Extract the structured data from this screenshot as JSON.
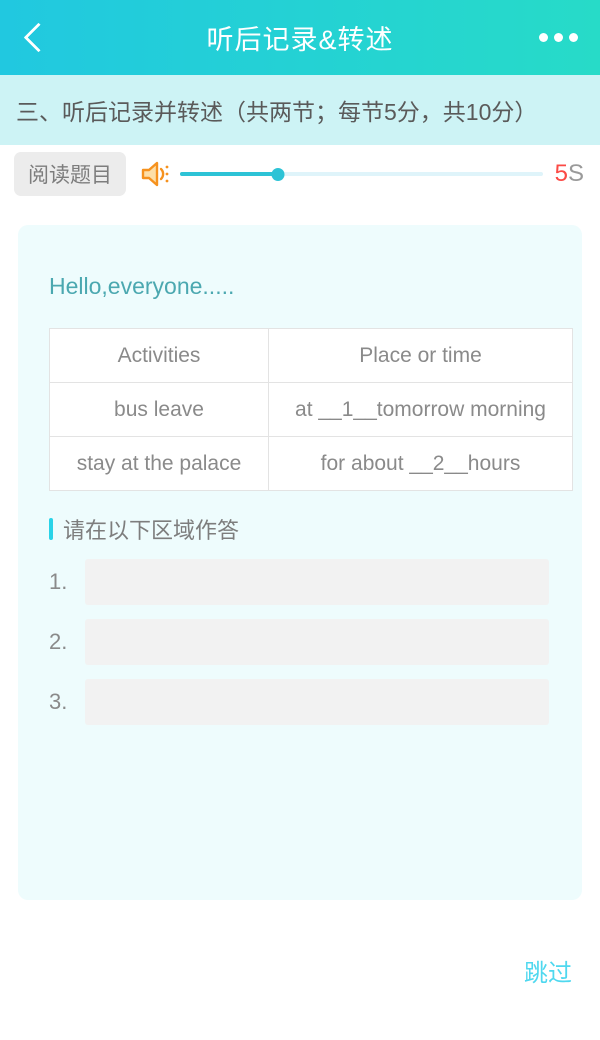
{
  "header": {
    "title": "听后记录&转述",
    "back_icon": "chevron-left-icon",
    "more_icon": "more-horizontal-icon",
    "accent_color": "#21c8e0"
  },
  "subtitle": {
    "text": "三、听后记录并转述（共两节；每节5分，共10分）",
    "background": "#cdf3f5"
  },
  "audio": {
    "read_button_label": "阅读题目",
    "speaker_icon": "speaker-volume-icon",
    "progress_percent": 27,
    "timer_value": "5",
    "timer_unit": "S",
    "timer_color": "#fb4a45",
    "track_color": "#2dc3d6"
  },
  "passage": {
    "title": "Hello,everyone.....",
    "title_color": "#4ba8b0"
  },
  "table": {
    "headers": [
      "Activities",
      "Place or time"
    ],
    "rows": [
      [
        "bus leave",
        "at __1__tomorrow morning"
      ],
      [
        "stay at the palace",
        "for about __2__hours"
      ]
    ]
  },
  "answer_section": {
    "heading": "请在以下区域作答",
    "accent_color": "#2ad3e8",
    "fields": [
      {
        "label": "1.",
        "value": "",
        "placeholder": ""
      },
      {
        "label": "2.",
        "value": "",
        "placeholder": ""
      },
      {
        "label": "3.",
        "value": "",
        "placeholder": ""
      }
    ]
  },
  "footer": {
    "skip_label": "跳过",
    "skip_color": "#4fd8ef"
  }
}
